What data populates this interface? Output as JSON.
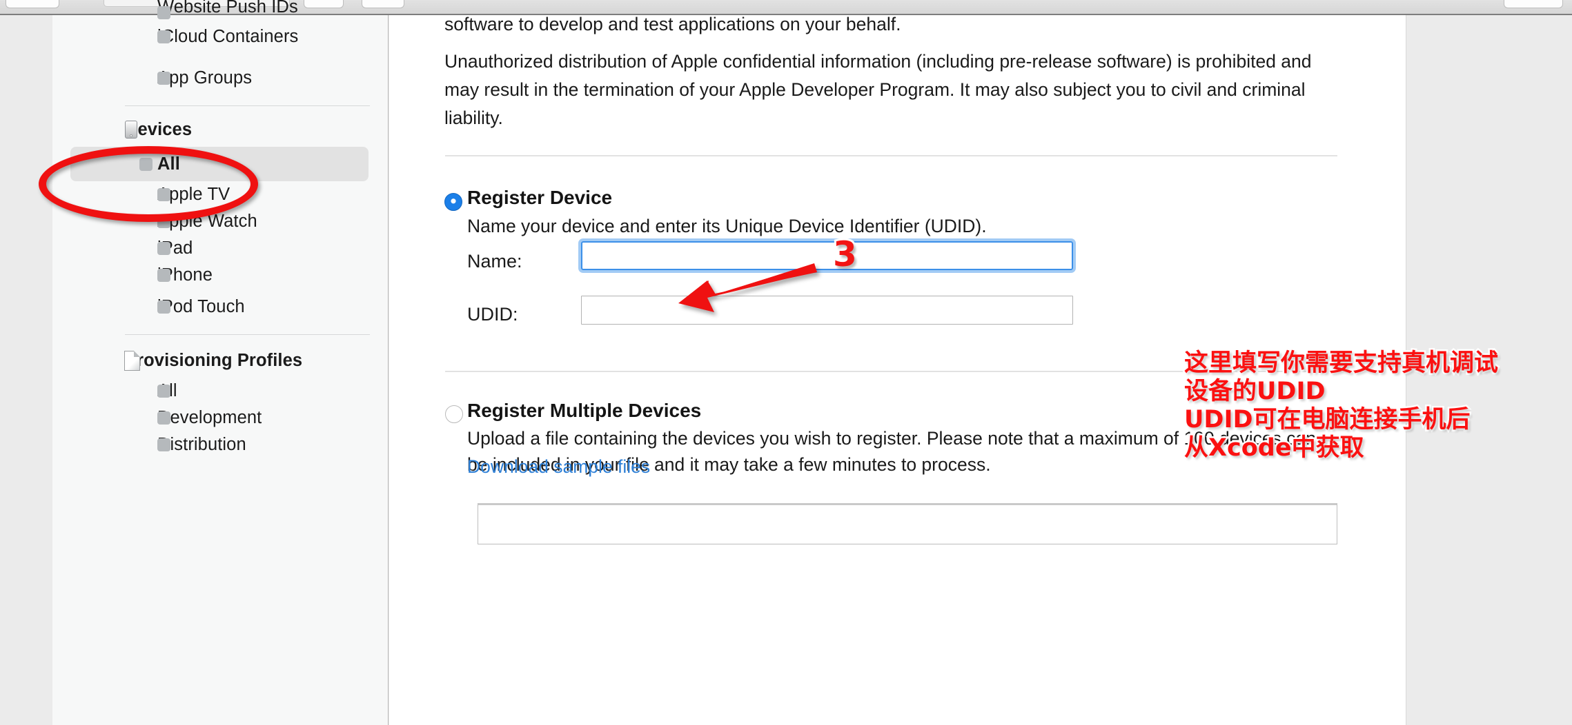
{
  "browser_chrome": {
    "buttons": [
      "nav-button-left",
      "url-bar",
      "toolbar-button-a",
      "toolbar-button-b",
      "toolbar-button-right"
    ]
  },
  "sidebar": {
    "groups": [
      {
        "items": [
          {
            "label": "Website Push IDs",
            "icon": "bullet-dot",
            "selected": false,
            "clipped": true
          },
          {
            "label": "iCloud Containers",
            "icon": "bullet-dot",
            "selected": false
          },
          {
            "label": "App Groups",
            "icon": "bullet-dot",
            "selected": false
          }
        ]
      },
      {
        "header": {
          "label": "Devices",
          "icon": "iphone-icon"
        },
        "items": [
          {
            "label": "All",
            "icon": "bullet-dot",
            "selected": true
          },
          {
            "label": "Apple TV",
            "icon": "bullet-dot",
            "selected": false
          },
          {
            "label": "Apple Watch",
            "icon": "bullet-dot",
            "selected": false
          },
          {
            "label": "iPad",
            "icon": "bullet-dot",
            "selected": false
          },
          {
            "label": "iPhone",
            "icon": "bullet-dot",
            "selected": false
          },
          {
            "label": "iPod Touch",
            "icon": "bullet-dot",
            "selected": false
          }
        ]
      },
      {
        "header": {
          "label": "Provisioning Profiles",
          "icon": "document-icon"
        },
        "items": [
          {
            "label": "All",
            "icon": "bullet-dot",
            "selected": false
          },
          {
            "label": "Development",
            "icon": "bullet-dot",
            "selected": false
          },
          {
            "label": "Distribution",
            "icon": "bullet-dot",
            "selected": false
          }
        ]
      }
    ]
  },
  "content": {
    "paragraph_clipped": "software to develop and test applications on your behalf.",
    "paragraph_warning": "Unauthorized distribution of Apple confidential information (including pre-release software) is prohibited and may result in the termination of your Apple Developer Program. It may also subject you to civil and criminal liability.",
    "register_device": {
      "title": "Register Device",
      "description": "Name your device and enter its Unique Device Identifier (UDID).",
      "selected": true,
      "fields": [
        {
          "label": "Name:",
          "value": "",
          "placeholder": "",
          "focused": true
        },
        {
          "label": "UDID:",
          "value": "",
          "placeholder": "",
          "focused": false
        }
      ]
    },
    "register_multiple": {
      "title": "Register Multiple Devices",
      "description": "Upload a file containing the devices you wish to register. Please note that a maximum of 100 devices can be included in your file and it may take a few minutes to process.",
      "link_label": "Download sample files",
      "selected": false
    }
  },
  "annotations": {
    "step_number": "3",
    "chinese_note": "这里填写你需要支持真机调试\n设备的UDID\nUDID可在电脑连接手机后\n从Xcode中获取",
    "ellipse_target": "Devices / All",
    "arrow_target": "Register Device"
  },
  "colors": {
    "annotation_red": "#f21414",
    "link_blue": "#2d7fd6",
    "radio_blue": "#1b7fe8",
    "sidebar_bg": "#f7f8f8",
    "selected_row": "#e2e2e2"
  }
}
